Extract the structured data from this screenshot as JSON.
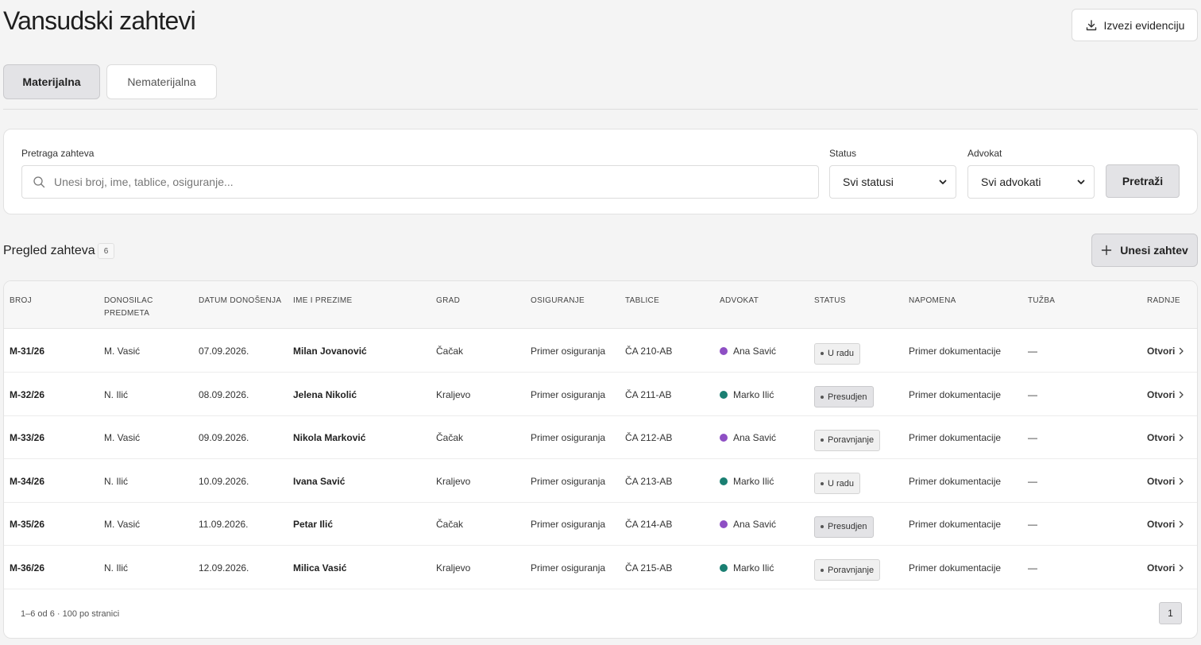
{
  "header": {
    "title": "Vansudski zahtevi",
    "export_label": "Izvezi evidenciju"
  },
  "tabs": [
    {
      "label": "Materijalna",
      "active": true
    },
    {
      "label": "Nematerijalna",
      "active": false
    }
  ],
  "filters": {
    "search_label": "Pretraga zahteva",
    "search_placeholder": "Unesi broj, ime, tablice, osiguranje...",
    "search_value": "",
    "status_label": "Status",
    "status_value": "Svi statusi",
    "lawyer_label": "Advokat",
    "lawyer_value": "Svi advokati",
    "search_button": "Pretraži"
  },
  "overview": {
    "title": "Pregled zahteva",
    "count": "6",
    "add_button": "Unesi zahtev"
  },
  "table": {
    "columns": [
      "BROJ",
      "DONOSILAC PREDMETA",
      "DATUM DONOŠENJA",
      "IME I PREZIME",
      "GRAD",
      "OSIGURANJE",
      "TABLICE",
      "ADVOKAT",
      "STATUS",
      "NAPOMENA",
      "TUŽBA",
      "RADNJE"
    ],
    "rows": [
      {
        "broj": "M-31/26",
        "donosilac": "M. Vasić",
        "datum": "07.09.2026.",
        "ime": "Milan Jovanović",
        "grad": "Čačak",
        "osiguranje": "Primer osiguranja",
        "tablice": "ČA 210-AB",
        "advokat": "Ana Savić",
        "advokat_color": "#8e4fc4",
        "status": "U radu",
        "napomena": "Primer dokumentacije",
        "tuzba": "—",
        "radnja": "Otvori"
      },
      {
        "broj": "M-32/26",
        "donosilac": "N. Ilić",
        "datum": "08.09.2026.",
        "ime": "Jelena Nikolić",
        "grad": "Kraljevo",
        "osiguranje": "Primer osiguranja",
        "tablice": "ČA 211-AB",
        "advokat": "Marko Ilić",
        "advokat_color": "#1a7f72",
        "status": "Presudjen",
        "napomena": "Primer dokumentacije",
        "tuzba": "—",
        "radnja": "Otvori"
      },
      {
        "broj": "M-33/26",
        "donosilac": "M. Vasić",
        "datum": "09.09.2026.",
        "ime": "Nikola Marković",
        "grad": "Čačak",
        "osiguranje": "Primer osiguranja",
        "tablice": "ČA 212-AB",
        "advokat": "Ana Savić",
        "advokat_color": "#8e4fc4",
        "status": "Poravnjanje",
        "napomena": "Primer dokumentacije",
        "tuzba": "—",
        "radnja": "Otvori"
      },
      {
        "broj": "M-34/26",
        "donosilac": "N. Ilić",
        "datum": "10.09.2026.",
        "ime": "Ivana Savić",
        "grad": "Kraljevo",
        "osiguranje": "Primer osiguranja",
        "tablice": "ČA 213-AB",
        "advokat": "Marko Ilić",
        "advokat_color": "#1a7f72",
        "status": "U radu",
        "napomena": "Primer dokumentacije",
        "tuzba": "—",
        "radnja": "Otvori"
      },
      {
        "broj": "M-35/26",
        "donosilac": "M. Vasić",
        "datum": "11.09.2026.",
        "ime": "Petar Ilić",
        "grad": "Čačak",
        "osiguranje": "Primer osiguranja",
        "tablice": "ČA 214-AB",
        "advokat": "Ana Savić",
        "advokat_color": "#8e4fc4",
        "status": "Presudjen",
        "napomena": "Primer dokumentacije",
        "tuzba": "—",
        "radnja": "Otvori"
      },
      {
        "broj": "M-36/26",
        "donosilac": "N. Ilić",
        "datum": "12.09.2026.",
        "ime": "Milica Vasić",
        "grad": "Kraljevo",
        "osiguranje": "Primer osiguranja",
        "tablice": "ČA 215-AB",
        "advokat": "Marko Ilić",
        "advokat_color": "#1a7f72",
        "status": "Poravnjanje",
        "napomena": "Primer dokumentacije",
        "tuzba": "—",
        "radnja": "Otvori"
      }
    ]
  },
  "pagination": {
    "summary": "1–6 od 6 · 100 po stranici",
    "current_page": "1"
  },
  "icons": {
    "export": "download-icon",
    "search": "search-icon",
    "select": "chevron-down-icon",
    "add": "plus-icon",
    "open": "chevron-right-icon"
  }
}
